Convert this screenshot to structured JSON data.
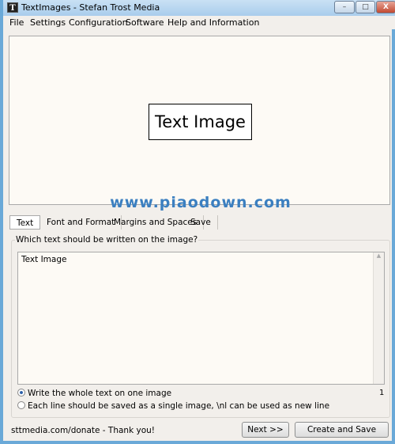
{
  "window": {
    "title": "TextImages - Stefan Trost Media",
    "app_icon_glyph": "T",
    "minimize": "–",
    "maximize": "□",
    "close": "X"
  },
  "menu": [
    "File",
    "Settings",
    "Configuration",
    "Software",
    "Help and Information"
  ],
  "preview": {
    "image_text": "Text Image",
    "background": "#fdfaf5"
  },
  "watermark": "www.piaodown.com",
  "tabs": [
    {
      "label": "Text",
      "active": true
    },
    {
      "label": "Font and Format"
    },
    {
      "label": "Margins and Spaces"
    },
    {
      "label": "Save"
    }
  ],
  "text_tab": {
    "group_label": "Which text should be written on the image?",
    "text_value": "Text Image",
    "line_count": "1",
    "options": [
      {
        "label": "Write the whole text on one image",
        "selected": true
      },
      {
        "label": "Each line should be saved as a single image, \\nl can be used as new line",
        "selected": false
      }
    ]
  },
  "footer": {
    "status": "sttmedia.com/donate - Thank you!",
    "next_label": "Next >>",
    "create_label": "Create and Save"
  }
}
